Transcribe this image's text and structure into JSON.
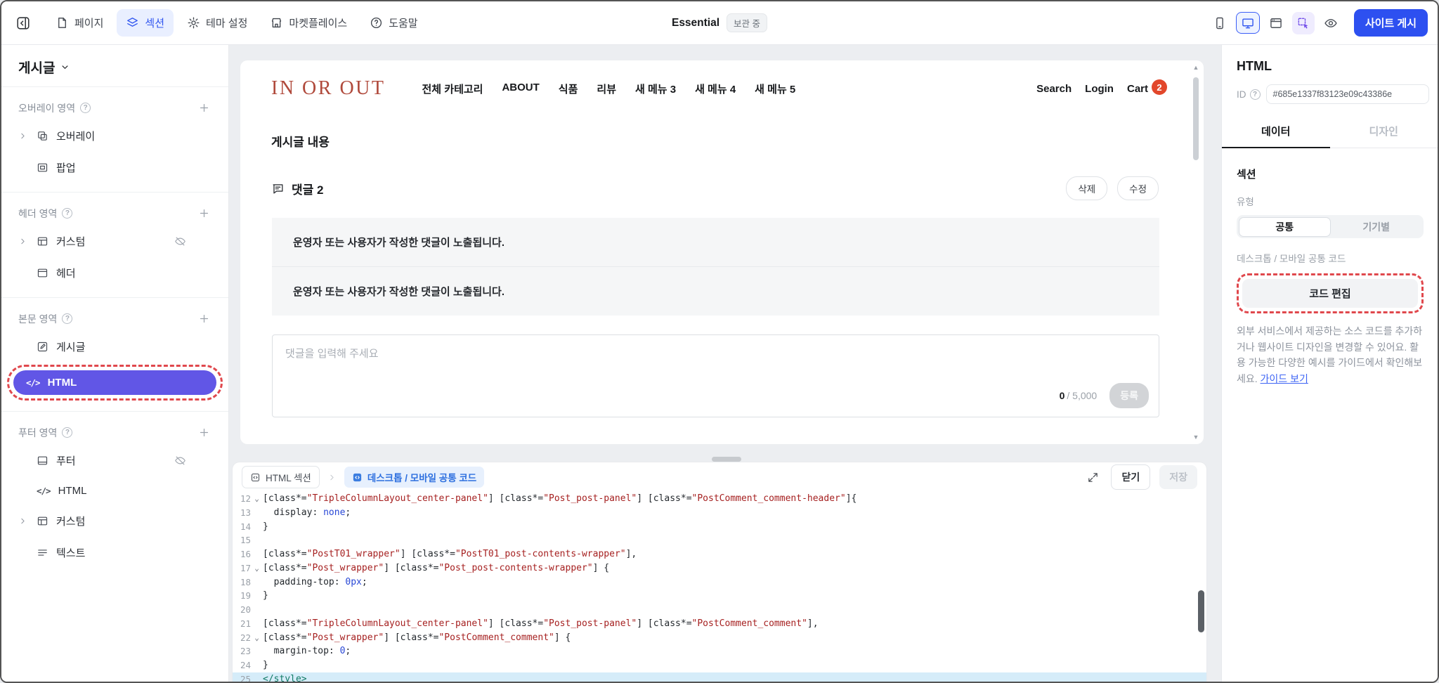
{
  "topbar": {
    "nav": [
      {
        "label": "페이지"
      },
      {
        "label": "섹션"
      },
      {
        "label": "테마 설정"
      },
      {
        "label": "마켓플레이스"
      },
      {
        "label": "도움말"
      }
    ],
    "plan": {
      "name": "Essential",
      "badge": "보관 중"
    },
    "publish_label": "사이트 게시"
  },
  "sidebar": {
    "title": "게시글",
    "groups": [
      {
        "label": "오버레이 영역",
        "items": [
          {
            "label": "오버레이"
          },
          {
            "label": "팝업"
          }
        ]
      },
      {
        "label": "헤더 영역",
        "items": [
          {
            "label": "커스텀"
          },
          {
            "label": "헤더"
          }
        ]
      },
      {
        "label": "본문 영역",
        "items": [
          {
            "label": "게시글"
          },
          {
            "label": "HTML"
          }
        ]
      },
      {
        "label": "푸터 영역",
        "items": [
          {
            "label": "푸터"
          },
          {
            "label": "HTML"
          },
          {
            "label": "커스텀"
          },
          {
            "label": "텍스트"
          }
        ]
      }
    ]
  },
  "canvas": {
    "site_header": {
      "logo": "IN OR OUT",
      "nav": [
        "전체 카테고리",
        "ABOUT",
        "식품",
        "리뷰",
        "새 메뉴 3",
        "새 메뉴 4",
        "새 메뉴 5"
      ],
      "utility": [
        "Search",
        "Login",
        "Cart"
      ],
      "cart_count": "2"
    },
    "post_title": "게시글 내용",
    "comment": {
      "header": "댓글 2",
      "delete_label": "삭제",
      "edit_label": "수정",
      "items": [
        "운영자 또는 사용자가 작성한 댓글이 노출됩니다.",
        "운영자 또는 사용자가 작성한 댓글이 노출됩니다."
      ],
      "placeholder": "댓글을 입력해 주세요",
      "count_current": "0",
      "count_max": "/ 5,000",
      "submit_label": "등록"
    }
  },
  "code_panel": {
    "section_chip": "HTML 섹션",
    "file_chip": "데스크톱 / 모바일 공통 코드",
    "close_label": "닫기",
    "save_label": "저장",
    "active_line": 25,
    "lines": [
      {
        "no": 12,
        "fold": true,
        "seg": [
          [
            "p",
            "[class*="
          ],
          [
            "s",
            "\"TripleColumnLayout_center-panel\""
          ],
          [
            "p",
            "] [class*="
          ],
          [
            "s",
            "\"Post_post-panel\""
          ],
          [
            "p",
            "] [class*="
          ],
          [
            "s",
            "\"PostComment_comment-header\""
          ],
          [
            "p",
            "]{"
          ]
        ]
      },
      {
        "no": 13,
        "seg": [
          [
            "p",
            "  display: "
          ],
          [
            "a",
            "none"
          ],
          [
            "p",
            ";"
          ]
        ]
      },
      {
        "no": 14,
        "seg": [
          [
            "p",
            "}"
          ]
        ]
      },
      {
        "no": 15,
        "seg": []
      },
      {
        "no": 16,
        "seg": [
          [
            "p",
            "[class*="
          ],
          [
            "s",
            "\"PostT01_wrapper\""
          ],
          [
            "p",
            "] [class*="
          ],
          [
            "s",
            "\"PostT01_post-contents-wrapper\""
          ],
          [
            "p",
            "],"
          ]
        ]
      },
      {
        "no": 17,
        "fold": true,
        "seg": [
          [
            "p",
            "[class*="
          ],
          [
            "s",
            "\"Post_wrapper\""
          ],
          [
            "p",
            "] [class*="
          ],
          [
            "s",
            "\"Post_post-contents-wrapper\""
          ],
          [
            "p",
            "] {"
          ]
        ]
      },
      {
        "no": 18,
        "seg": [
          [
            "p",
            "  padding-top: "
          ],
          [
            "n",
            "0px"
          ],
          [
            "p",
            ";"
          ]
        ]
      },
      {
        "no": 19,
        "seg": [
          [
            "p",
            "}"
          ]
        ]
      },
      {
        "no": 20,
        "seg": []
      },
      {
        "no": 21,
        "seg": [
          [
            "p",
            "[class*="
          ],
          [
            "s",
            "\"TripleColumnLayout_center-panel\""
          ],
          [
            "p",
            "] [class*="
          ],
          [
            "s",
            "\"Post_post-panel\""
          ],
          [
            "p",
            "] [class*="
          ],
          [
            "s",
            "\"PostComment_comment\""
          ],
          [
            "p",
            "],"
          ]
        ]
      },
      {
        "no": 22,
        "fold": true,
        "seg": [
          [
            "p",
            "[class*="
          ],
          [
            "s",
            "\"Post_wrapper\""
          ],
          [
            "p",
            "] [class*="
          ],
          [
            "s",
            "\"PostComment_comment\""
          ],
          [
            "p",
            "] {"
          ]
        ]
      },
      {
        "no": 23,
        "seg": [
          [
            "p",
            "  margin-top: "
          ],
          [
            "n",
            "0"
          ],
          [
            "p",
            ";"
          ]
        ]
      },
      {
        "no": 24,
        "seg": [
          [
            "p",
            "}"
          ]
        ]
      },
      {
        "no": 25,
        "seg": [
          [
            "t",
            "</style>"
          ]
        ]
      }
    ]
  },
  "inspector": {
    "title": "HTML",
    "id_label": "ID",
    "id_value": "#685e1337f83123e09c43386e",
    "tabs": [
      {
        "label": "데이터"
      },
      {
        "label": "디자인"
      }
    ],
    "section_label": "섹션",
    "type_label": "유형",
    "type_options": [
      {
        "label": "공통"
      },
      {
        "label": "기기별"
      }
    ],
    "code_label": "데스크톱 / 모바일 공통 코드",
    "edit_code_label": "코드 편집",
    "help_text": "외부 서비스에서 제공하는 소스 코드를 추가하거나 웹사이트 디자인을 변경할 수 있어요. 활용 가능한 다양한 예시를 가이드에서 확인해보세요. ",
    "guide_link_label": "가이드 보기"
  },
  "colors": {
    "accent_blue": "#2d50f0",
    "selection_purple": "#6156e6",
    "annotation_red": "#e0484d",
    "cart_badge_red": "#e2472b",
    "logo_brown": "#b04a3c",
    "active_line_blue": "#d5ecf9"
  }
}
